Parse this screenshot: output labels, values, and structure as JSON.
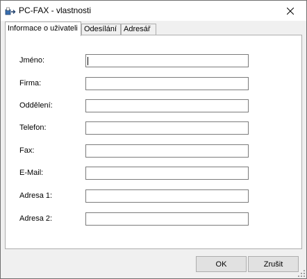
{
  "window": {
    "title": "PC-FAX - vlastnosti"
  },
  "tabs": [
    {
      "label": "Informace o uživateli",
      "active": true
    },
    {
      "label": "Odesílání",
      "active": false
    },
    {
      "label": "Adresář",
      "active": false
    }
  ],
  "form": {
    "fields": [
      {
        "label": "Jméno:",
        "value": ""
      },
      {
        "label": "Firma:",
        "value": ""
      },
      {
        "label": "Oddělení:",
        "value": ""
      },
      {
        "label": "Telefon:",
        "value": ""
      },
      {
        "label": "Fax:",
        "value": ""
      },
      {
        "label": "E-Mail:",
        "value": ""
      },
      {
        "label": "Adresa 1:",
        "value": ""
      },
      {
        "label": "Adresa 2:",
        "value": ""
      }
    ]
  },
  "buttons": {
    "ok": "OK",
    "cancel": "Zrušit"
  }
}
